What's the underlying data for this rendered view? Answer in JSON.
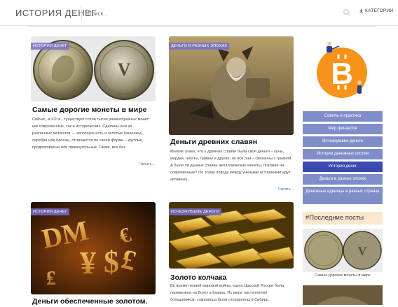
{
  "header": {
    "logo": "ИСТОРИЯ ДЕНЕГ",
    "search_placeholder": "Поиск...",
    "categories_label": "КАТЕГОРИИ"
  },
  "posts": [
    {
      "badge": "ИСТОРИЯ ДЕНЕГ",
      "title": "Самые дорогие монеты в мире",
      "text": "Сейчас, в XXI в., существует сотни тысяч разнообразных монет: как современных, так и исторических. Сделаны они из различных металлов — золото(но есть и золотые банкноты), серебра или бронзы, отличаются по своей форме – круглые, продолговатые или прямоугольные. Также, все без",
      "more": "Читать..."
    },
    {
      "badge": "ДЕНЬГИ В РАЗНЫХ ЭПОХАХ",
      "title": "Деньги древних славян",
      "text": "Многие знают, что у древних славян были свои деньги – куны, мордки, ногаты, гривны и другие, но все они – связанны с гривной. А были ли данных славян металлические монеты, похожие на современные? По этому поводу между учеными историками идут активные",
      "more": "Читать..."
    },
    {
      "badge": "ИСТОРИЯ ДЕНЕГ",
      "title": "Деньги обеспеченные золотом.",
      "text": "",
      "more": ""
    },
    {
      "badge": "ИСЧЕЗНУВШИЕ ДЕНЬГИ",
      "title": "Золото колчака",
      "text": "Во время первой мировой войны, казна Царской России была перевезена на Волгу в Казань. По мере наступления большевиков, сокровища были отправлены в Сибирь.",
      "more": ""
    }
  ],
  "sidebar": {
    "menu": [
      "Советы и практика",
      "Мир финансов",
      "Исчезнувшие деньги",
      "Истории денежных систем",
      "История денег",
      "Деньги в разных эпохах",
      "Денежные единицы в разных странах"
    ],
    "recent_title": "#Последние посты",
    "recent_caption": "Самые дорогие монеты в мире"
  },
  "colors": {
    "menu": "#7f8ec9",
    "menu_active": "#3a4ab0",
    "badge": "#786ec8",
    "link": "#3b6ab7",
    "bitcoin": "#f7931a"
  },
  "icons": [
    "search-icon",
    "categories-icon",
    "bitcoin-icon"
  ]
}
